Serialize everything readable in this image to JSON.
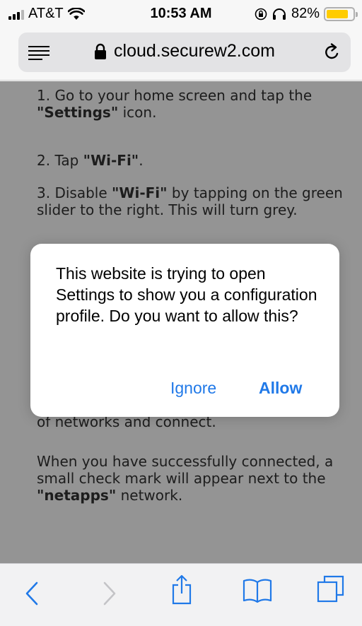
{
  "status": {
    "carrier": "AT&T",
    "time": "10:53 AM",
    "battery_percent": "82%",
    "battery_level": 0.82
  },
  "browser": {
    "url": "cloud.securew2.com"
  },
  "page": {
    "step1_pre": "1. Go to your home screen and tap the ",
    "step1_bold": "\"Settings\"",
    "step1_post": " icon.",
    "step2_pre": "2. Tap ",
    "step2_bold": "\"Wi-Fi\"",
    "step2_post": ".",
    "step3_pre": "3. Disable ",
    "step3_bold": "\"Wi-Fi\"",
    "step3_post": " by tapping on the green slider to the right. This will turn grey.",
    "step_partial": "of networks and connect.",
    "final_pre": "When you have successfully connected, a small check mark will appear next to the ",
    "final_bold": "\"netapps\"",
    "final_post": " network."
  },
  "alert": {
    "message": "This website is trying to open Settings to show you a configuration profile. Do you want to allow this?",
    "ignore_label": "Ignore",
    "allow_label": "Allow"
  },
  "colors": {
    "link_blue": "#2079e8",
    "battery_yellow": "#ffcc00"
  },
  "icons": [
    "signal-icon",
    "wifi-icon",
    "orientation-lock-icon",
    "headphones-icon",
    "battery-icon",
    "menu-icon",
    "lock-icon",
    "reload-icon",
    "back-icon",
    "forward-icon",
    "share-icon",
    "bookmarks-icon",
    "tabs-icon"
  ]
}
